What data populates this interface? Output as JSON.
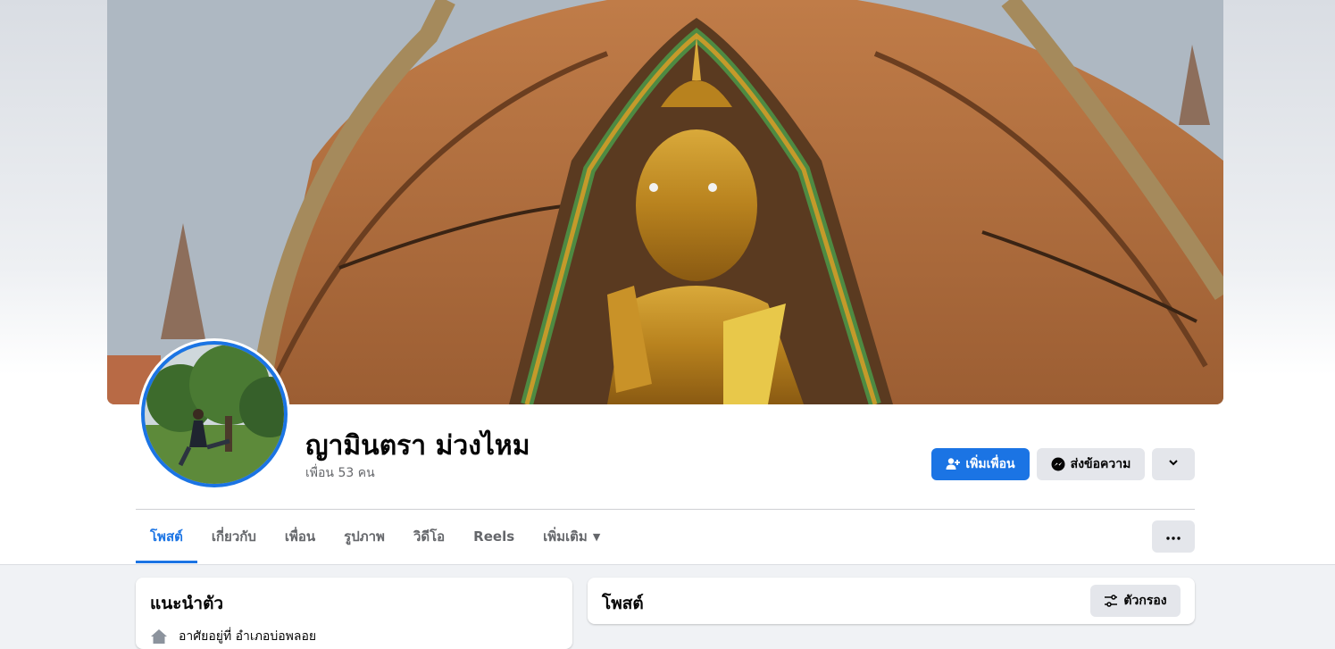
{
  "profile": {
    "name": "ญามินตรา ม่วงไหม",
    "friends_count_text": "เพื่อน 53 คน"
  },
  "actions": {
    "add_friend_label": "เพิ่มเพื่อน",
    "message_label": "ส่งข้อความ",
    "more_icon": "chevron-down-icon"
  },
  "tabs": [
    {
      "label": "โพสต์",
      "active": true
    },
    {
      "label": "เกี่ยวกับ",
      "active": false
    },
    {
      "label": "เพื่อน",
      "active": false
    },
    {
      "label": "รูปภาพ",
      "active": false
    },
    {
      "label": "วิดีโอ",
      "active": false
    },
    {
      "label": "Reels",
      "active": false
    },
    {
      "label": "เพิ่มเติม",
      "active": false
    }
  ],
  "intro": {
    "title": "แนะนำตัว",
    "rows": [
      {
        "icon": "home-icon",
        "text": "อาศัยอยู่ที่ อำเภอบ่อพลอย"
      }
    ]
  },
  "posts": {
    "title": "โพสต์",
    "filter_label": "ตัวกรอง"
  },
  "colors": {
    "accent": "#1b74e4",
    "button_gray": "#e4e6eb",
    "page_bg": "#f0f2f5",
    "secondary_text": "#65676b"
  }
}
